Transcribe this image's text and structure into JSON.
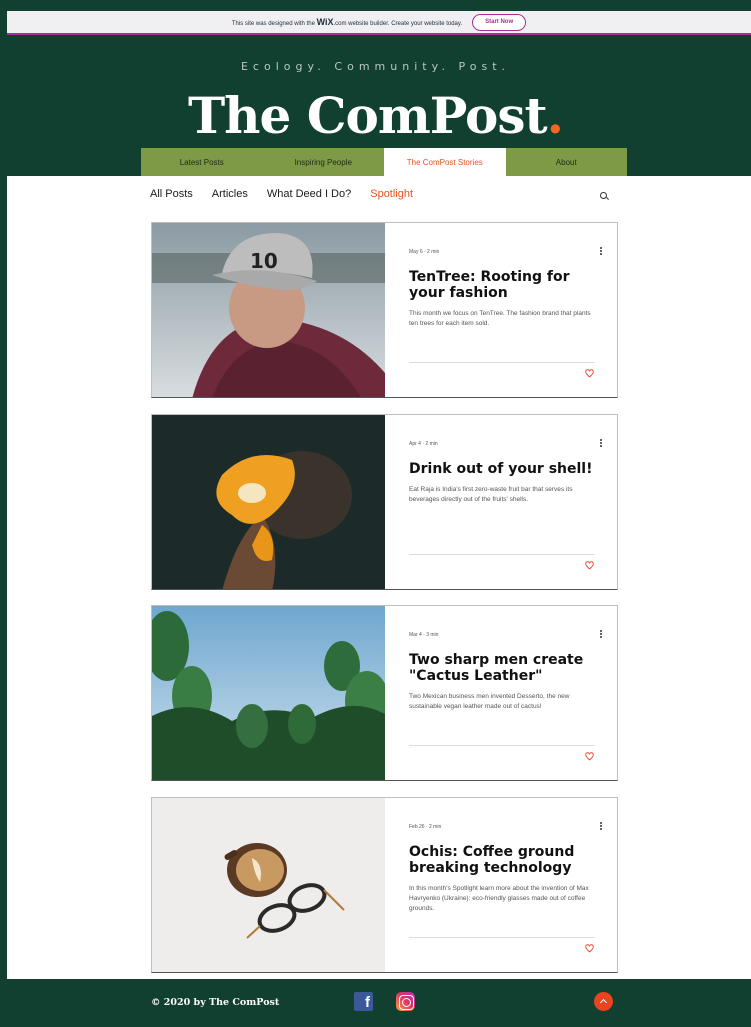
{
  "banner": {
    "text_before": "This site was designed with the",
    "logo": "WiX",
    "text_after": ".com website builder. Create your website today.",
    "button": "Start Now"
  },
  "header": {
    "tagline": "Ecology. Community. Post.",
    "title": "The ComPost",
    "title_dot": "."
  },
  "main_nav": [
    "Latest Posts",
    "Inspiring People",
    "The ComPost Stories",
    "About"
  ],
  "category_nav": [
    "All Posts",
    "Articles",
    "What Deed I Do?",
    "Spotlight"
  ],
  "posts": [
    {
      "meta": "May 6 · 2 min",
      "title": "TenTree: Rooting for your fashion",
      "desc": "This month we focus on TenTree. The fashion brand that plants ten trees for each item sold."
    },
    {
      "meta": "Apr 4 · 2 min",
      "title": "Drink out of your shell!",
      "desc": "Eat Raja is India's first zero-waste fruit bar that serves its beverages directly out of the fruits' shells."
    },
    {
      "meta": "Mar 4 · 3 min",
      "title": "Two sharp men create \"Cactus Leather\"",
      "desc": "Two Mexican business men invented Desserto, the new sustainable vegan leather made out of cactus!"
    },
    {
      "meta": "Feb 26 · 2 min",
      "title": "Ochis: Coffee ground breaking technology",
      "desc": "In this month's Spotlight learn more about the invention of Max Havryenko (Ukraine): eco-friendly glasses made out of coffee grounds."
    }
  ],
  "footer": {
    "copyright": "© 2020 by The ComPost",
    "facebook_glyph": "f"
  },
  "colors": {
    "dark_green": "#113f30",
    "olive": "#7f9a47",
    "accent": "#e9531d",
    "wix_purple": "#a52f96"
  }
}
